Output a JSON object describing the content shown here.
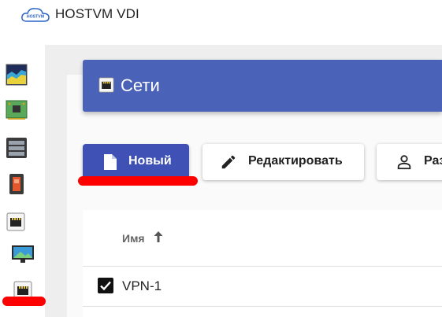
{
  "app": {
    "title": "HOSTVM VDI",
    "logo_text": "HOSTVM"
  },
  "sidebar": {
    "items": [
      {
        "icon": "dashboard-chart-icon"
      },
      {
        "icon": "circuit-board-icon"
      },
      {
        "icon": "server-rack-icon"
      },
      {
        "icon": "power-switch-icon"
      },
      {
        "icon": "network-port-icon"
      },
      {
        "icon": "monitor-icon"
      },
      {
        "icon": "network-port-icon",
        "active": true
      }
    ]
  },
  "header": {
    "title": "Сети",
    "icon": "network-port-icon"
  },
  "toolbar": {
    "new_label": "Новый",
    "edit_label": "Редактировать",
    "third_label": "Раз"
  },
  "table": {
    "columns": [
      {
        "label": "Имя",
        "sort": "asc"
      }
    ],
    "rows": [
      {
        "name": "VPN-1",
        "checked": true
      }
    ]
  },
  "colors": {
    "header_bg": "#4a63b9",
    "primary_button": "#3f51b5",
    "annotation": "#ff0000"
  }
}
